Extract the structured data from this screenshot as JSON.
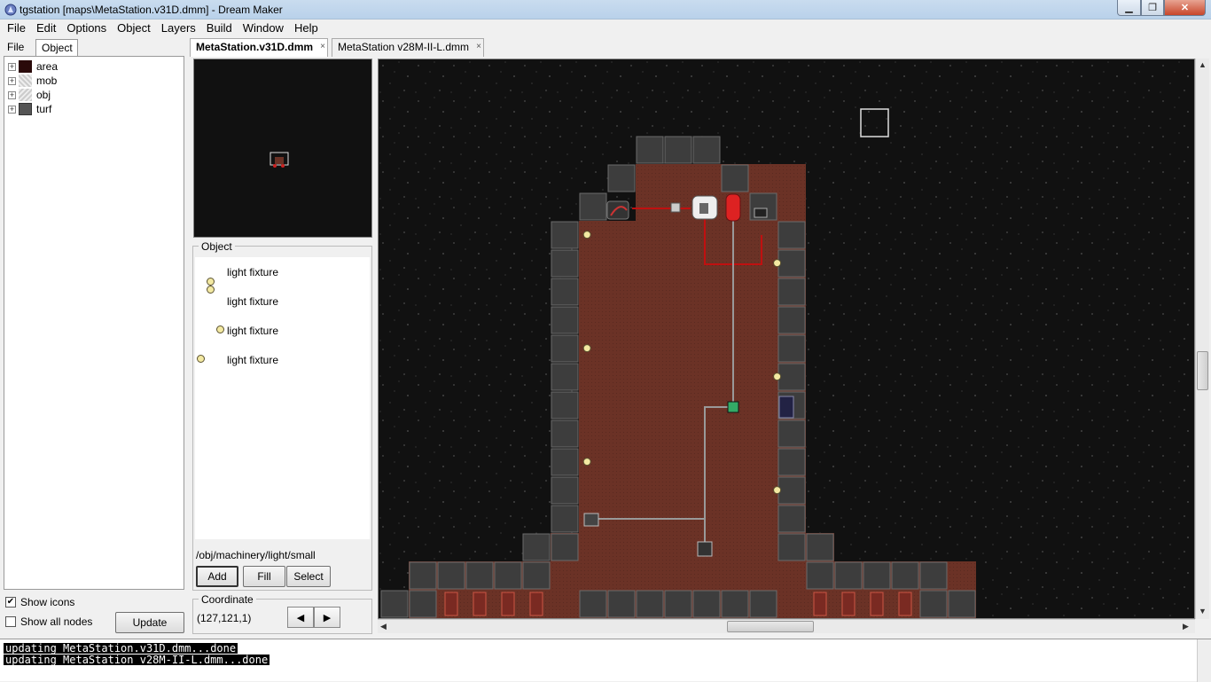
{
  "window": {
    "title": "tgstation [maps\\MetaStation.v31D.dmm] - Dream Maker",
    "minimize": "▁",
    "maximize": "❐",
    "close": "✕"
  },
  "menu": [
    "File",
    "Edit",
    "Options",
    "Object",
    "Layers",
    "Build",
    "Window",
    "Help"
  ],
  "left_panel": {
    "tabs": [
      "File",
      "Object"
    ],
    "active_tab": "Object",
    "tree": [
      {
        "label": "area",
        "icon": "area-icon"
      },
      {
        "label": "mob",
        "icon": "mob-icon"
      },
      {
        "label": "obj",
        "icon": "obj-icon"
      },
      {
        "label": "turf",
        "icon": "turf-icon"
      }
    ],
    "show_icons": {
      "label": "Show icons",
      "checked": true
    },
    "show_all_nodes": {
      "label": "Show all nodes",
      "checked": false
    },
    "update_button": "Update"
  },
  "map_tabs": [
    {
      "label": "MetaStation.v31D.dmm",
      "active": true
    },
    {
      "label": "MetaStation v28M-II-L.dmm",
      "active": false
    }
  ],
  "object_panel": {
    "title": "Object",
    "items": [
      "light fixture",
      "light fixture",
      "light fixture",
      "light fixture"
    ],
    "path": "/obj/machinery/light/small",
    "buttons": {
      "add": "Add",
      "fill": "Fill",
      "select": "Select"
    }
  },
  "coordinate": {
    "title": "Coordinate",
    "value": "(127,121,1)",
    "prev": "◀",
    "next": "▶"
  },
  "output": {
    "lines": [
      "updating MetaStation.v31D.dmm...done",
      "updating MetaStation v28M-II-L.dmm...done"
    ]
  },
  "colors": {
    "space": "#111111",
    "wall": "#3d3d3d",
    "floor": "#6b3226",
    "accent_red": "#d01010"
  }
}
